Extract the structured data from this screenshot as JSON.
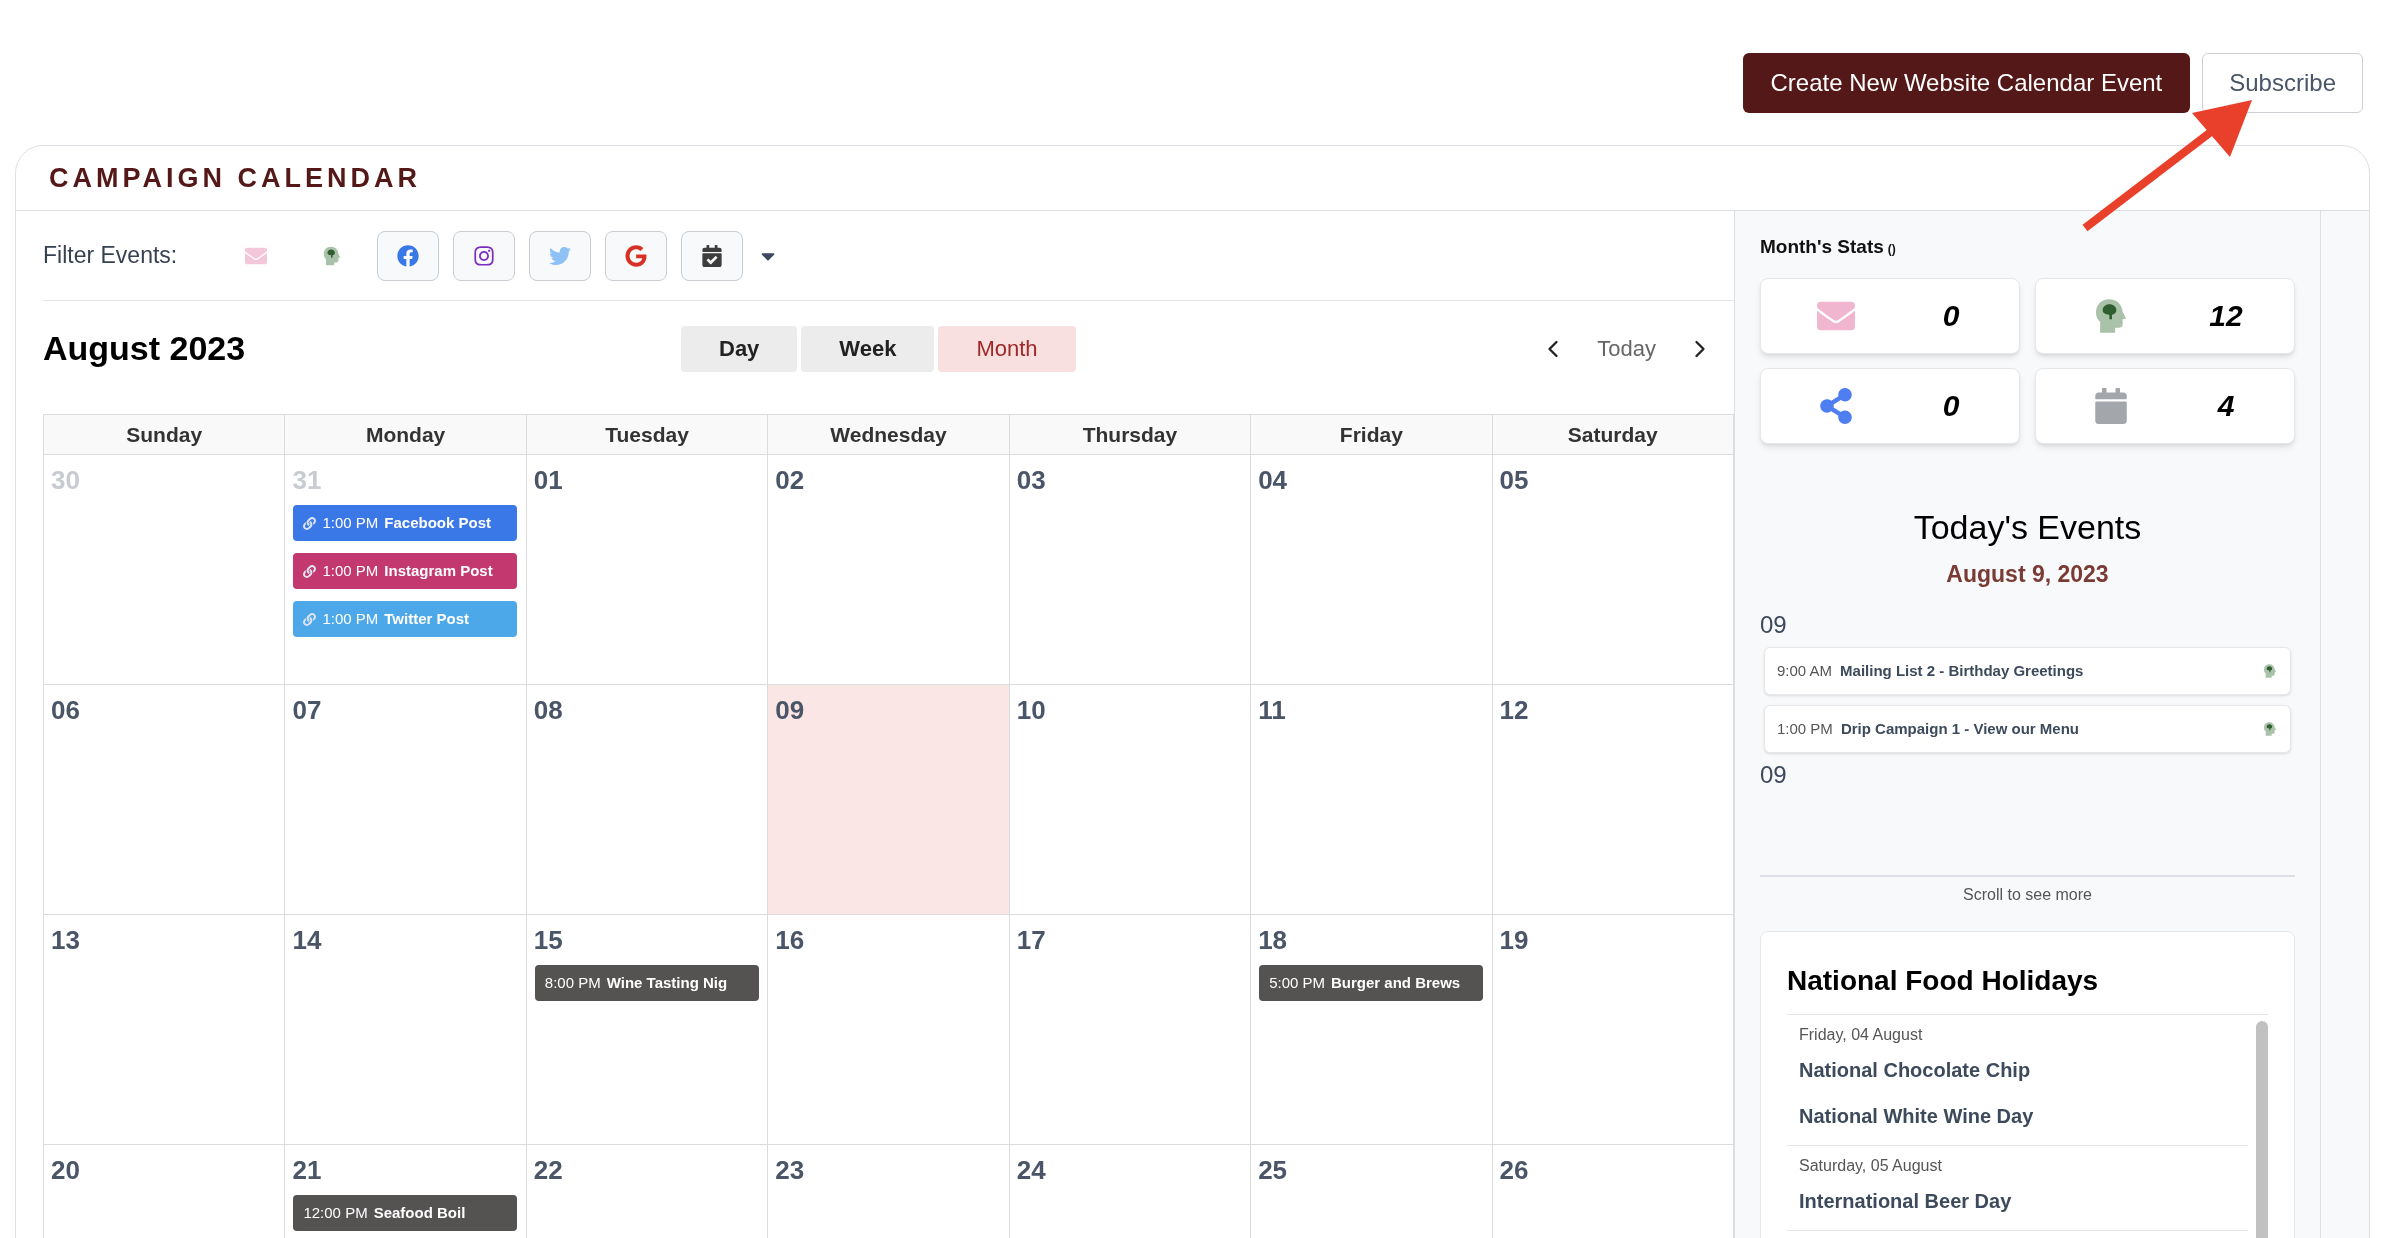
{
  "header": {
    "buttons": [
      {
        "label": "Create New Website Calendar Event",
        "kind": "primary"
      },
      {
        "label": "Subscribe",
        "kind": "secondary"
      }
    ]
  },
  "calendar": {
    "title": "CAMPAIGN CALENDAR",
    "filter_label": "Filter Events:",
    "filters": [
      {
        "kind": "email",
        "active": false
      },
      {
        "kind": "drip",
        "active": false
      },
      {
        "kind": "facebook",
        "active": true
      },
      {
        "kind": "instagram",
        "active": true
      },
      {
        "kind": "twitter",
        "active": true
      },
      {
        "kind": "google",
        "active": true
      },
      {
        "kind": "calendar",
        "active": true
      }
    ],
    "month_title": "August 2023",
    "views": [
      {
        "label": "Day",
        "selected": false
      },
      {
        "label": "Week",
        "selected": false
      },
      {
        "label": "Month",
        "selected": true
      }
    ],
    "today_button": "Today",
    "weekdays": [
      "Sunday",
      "Monday",
      "Tuesday",
      "Wednesday",
      "Thursday",
      "Friday",
      "Saturday"
    ],
    "weeks": [
      [
        {
          "day": "30",
          "muted": true,
          "today": false
        },
        {
          "day": "31",
          "muted": true,
          "today": false,
          "events": [
            {
              "time": "1:00 PM",
              "title": "Facebook Post",
              "linked": true,
              "color": "#3b78e7"
            },
            {
              "time": "1:00 PM",
              "title": "Instagram Post",
              "linked": true,
              "color": "#c2386f"
            },
            {
              "time": "1:00 PM",
              "title": "Twitter Post",
              "linked": true,
              "color": "#4ca8e8"
            }
          ]
        },
        {
          "day": "01",
          "muted": false,
          "today": false
        },
        {
          "day": "02",
          "muted": false,
          "today": false
        },
        {
          "day": "03",
          "muted": false,
          "today": false
        },
        {
          "day": "04",
          "muted": false,
          "today": false
        },
        {
          "day": "05",
          "muted": false,
          "today": false
        }
      ],
      [
        {
          "day": "06",
          "muted": false,
          "today": false
        },
        {
          "day": "07",
          "muted": false,
          "today": false
        },
        {
          "day": "08",
          "muted": false,
          "today": false
        },
        {
          "day": "09",
          "muted": false,
          "today": true
        },
        {
          "day": "10",
          "muted": false,
          "today": false
        },
        {
          "day": "11",
          "muted": false,
          "today": false
        },
        {
          "day": "12",
          "muted": false,
          "today": false
        }
      ],
      [
        {
          "day": "13",
          "muted": false,
          "today": false
        },
        {
          "day": "14",
          "muted": false,
          "today": false
        },
        {
          "day": "15",
          "muted": false,
          "today": false,
          "events": [
            {
              "time": "8:00 PM",
              "title": "Wine Tasting Nig",
              "linked": false,
              "color": "#555252"
            }
          ]
        },
        {
          "day": "16",
          "muted": false,
          "today": false
        },
        {
          "day": "17",
          "muted": false,
          "today": false
        },
        {
          "day": "18",
          "muted": false,
          "today": false,
          "events": [
            {
              "time": "5:00 PM",
              "title": "Burger and Brews",
              "linked": false,
              "color": "#555252"
            }
          ]
        },
        {
          "day": "19",
          "muted": false,
          "today": false
        }
      ],
      [
        {
          "day": "20",
          "muted": false,
          "today": false
        },
        {
          "day": "21",
          "muted": false,
          "today": false,
          "events": [
            {
              "time": "12:00 PM",
              "title": "Seafood Boil",
              "linked": false,
              "color": "#555252"
            }
          ]
        },
        {
          "day": "22",
          "muted": false,
          "today": false
        },
        {
          "day": "23",
          "muted": false,
          "today": false
        },
        {
          "day": "24",
          "muted": false,
          "today": false
        },
        {
          "day": "25",
          "muted": false,
          "today": false
        },
        {
          "day": "26",
          "muted": false,
          "today": false
        }
      ]
    ]
  },
  "sidebar": {
    "stats_title": "Month's Stats",
    "stats_suffix": "()",
    "stats": [
      {
        "kind": "email",
        "value": "0"
      },
      {
        "kind": "drip",
        "value": "12"
      },
      {
        "kind": "social",
        "value": "0"
      },
      {
        "kind": "calendar",
        "value": "4"
      }
    ],
    "todays_events_title": "Today's Events",
    "todays_date": "August 9, 2023",
    "groups": [
      {
        "label": "09",
        "events": [
          {
            "time": "9:00 AM",
            "title": "Mailing List 2 - Birthday Greetings"
          },
          {
            "time": "1:00 PM",
            "title": "Drip Campaign 1 - View our Menu"
          }
        ]
      },
      {
        "label": "09"
      }
    ],
    "scroll_hint": "Scroll to see more",
    "holidays": {
      "title": "National Food Holidays",
      "days": [
        {
          "date": "Friday, 04 August",
          "items": [
            "National Chocolate Chip",
            "National White Wine Day"
          ]
        },
        {
          "date": "Saturday, 05 August",
          "items": [
            "International Beer Day"
          ]
        }
      ]
    }
  }
}
